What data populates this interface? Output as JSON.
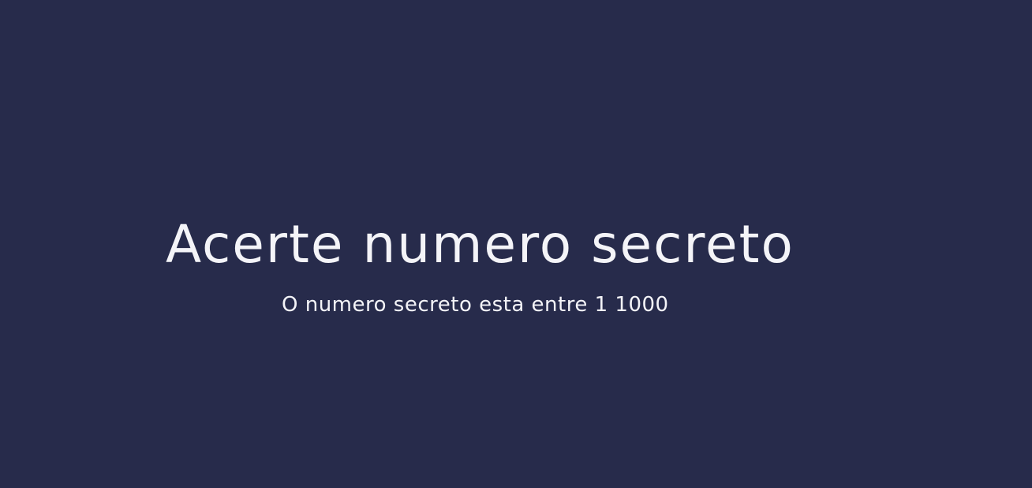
{
  "colors": {
    "background": "#272b4b",
    "text": "#f4f4f8"
  },
  "main": {
    "title": "Acerte numero secreto",
    "subtitle": "O numero secreto esta entre 1 1000"
  }
}
